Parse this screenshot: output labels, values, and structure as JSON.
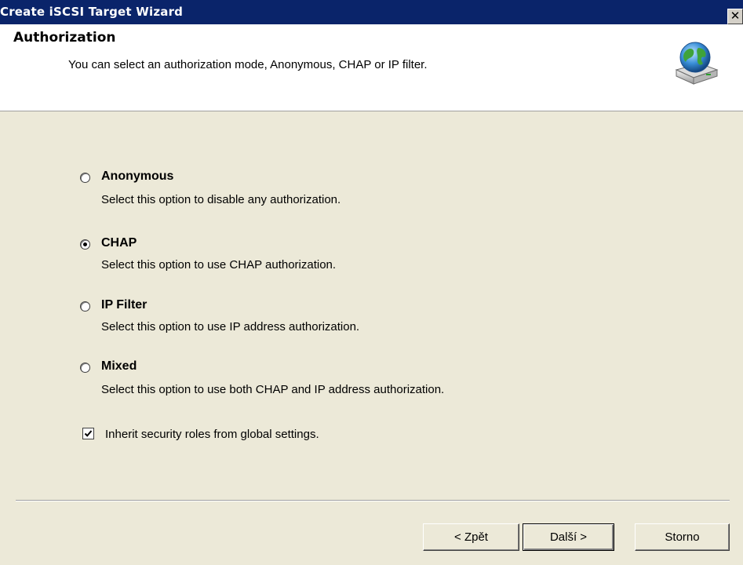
{
  "window": {
    "title": "Create iSCSI Target Wizard",
    "close_glyph": "✕"
  },
  "header": {
    "title": "Authorization",
    "subtitle": "You can select an authorization mode, Anonymous, CHAP or IP filter.",
    "icon": "globe-network-drive-icon"
  },
  "options": [
    {
      "label": "Anonymous",
      "description": "Select this option to disable any authorization.",
      "selected": false
    },
    {
      "label": "CHAP",
      "description": "Select this option to use CHAP authorization.",
      "selected": true
    },
    {
      "label": "IP Filter",
      "description": "Select this option to use IP address authorization.",
      "selected": false
    },
    {
      "label": "Mixed",
      "description": "Select this option to use both CHAP and IP address authorization.",
      "selected": false
    }
  ],
  "inherit_checkbox": {
    "label": "Inherit security roles from global settings.",
    "checked": true
  },
  "buttons": {
    "back": "< Zpět",
    "next": "Další >",
    "cancel": "Storno"
  }
}
